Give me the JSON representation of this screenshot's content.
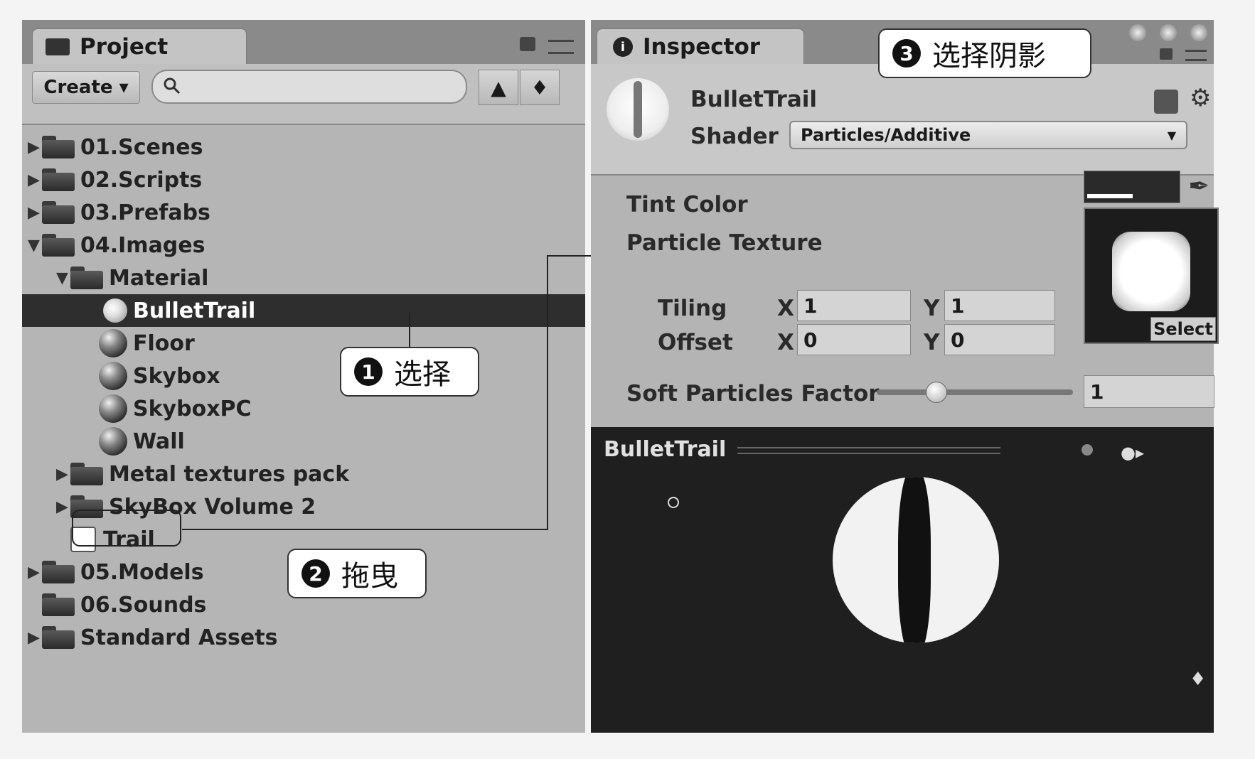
{
  "project": {
    "tab_label": "Project",
    "create_label": "Create ▾",
    "tree": [
      {
        "label": "01.Scenes",
        "arrow": "▶",
        "icon": "folder",
        "indent": 0
      },
      {
        "label": "02.Scripts",
        "arrow": "▶",
        "icon": "folder",
        "indent": 0
      },
      {
        "label": "03.Prefabs",
        "arrow": "▶",
        "icon": "folder",
        "indent": 0
      },
      {
        "label": "04.Images",
        "arrow": "▼",
        "icon": "folder",
        "indent": 0
      },
      {
        "label": "Material",
        "arrow": "▼",
        "icon": "folder",
        "indent": 1
      },
      {
        "label": "BulletTrail",
        "arrow": "",
        "icon": "material",
        "indent": 2,
        "selected": true
      },
      {
        "label": "Floor",
        "arrow": "",
        "icon": "sphere",
        "indent": 2
      },
      {
        "label": "Skybox",
        "arrow": "",
        "icon": "sphere",
        "indent": 2
      },
      {
        "label": "SkyboxPC",
        "arrow": "",
        "icon": "sphere",
        "indent": 2
      },
      {
        "label": "Wall",
        "arrow": "",
        "icon": "sphere",
        "indent": 2
      },
      {
        "label": "Metal textures pack",
        "arrow": "▶",
        "icon": "folder",
        "indent": 1
      },
      {
        "label": "SkyBox Volume 2",
        "arrow": "▶",
        "icon": "folder",
        "indent": 1
      },
      {
        "label": "Trail",
        "arrow": "",
        "icon": "texture",
        "indent": 1
      },
      {
        "label": "05.Models",
        "arrow": "▶",
        "icon": "folder",
        "indent": 0
      },
      {
        "label": "06.Sounds",
        "arrow": "",
        "icon": "folder",
        "indent": 0
      },
      {
        "label": "Standard Assets",
        "arrow": "▶",
        "icon": "folder",
        "indent": 0
      }
    ]
  },
  "inspector": {
    "tab_label": "Inspector",
    "material_name": "BulletTrail",
    "shader_label": "Shader",
    "shader_value": "Particles/Additive",
    "tint_color_label": "Tint Color",
    "particle_texture_label": "Particle Texture",
    "tiling_label": "Tiling",
    "offset_label": "Offset",
    "tiling_x": "1",
    "tiling_y": "1",
    "offset_x": "0",
    "offset_y": "0",
    "x_label": "X",
    "y_label": "Y",
    "select_label": "Select",
    "soft_particles_label": "Soft Particles Factor",
    "soft_particles_value": "1",
    "soft_particles_slider": 0.3
  },
  "preview": {
    "title": "BulletTrail"
  },
  "callouts": {
    "step1_num": "1",
    "step1_text": "选择",
    "step2_num": "2",
    "step2_text": "拖曳",
    "step3_num": "3",
    "step3_text": "选择阴影"
  },
  "colors": {
    "panel_bg": "#b5b5b5",
    "selected_row": "#2e2e2e",
    "preview_bg": "#1f1f1f"
  }
}
